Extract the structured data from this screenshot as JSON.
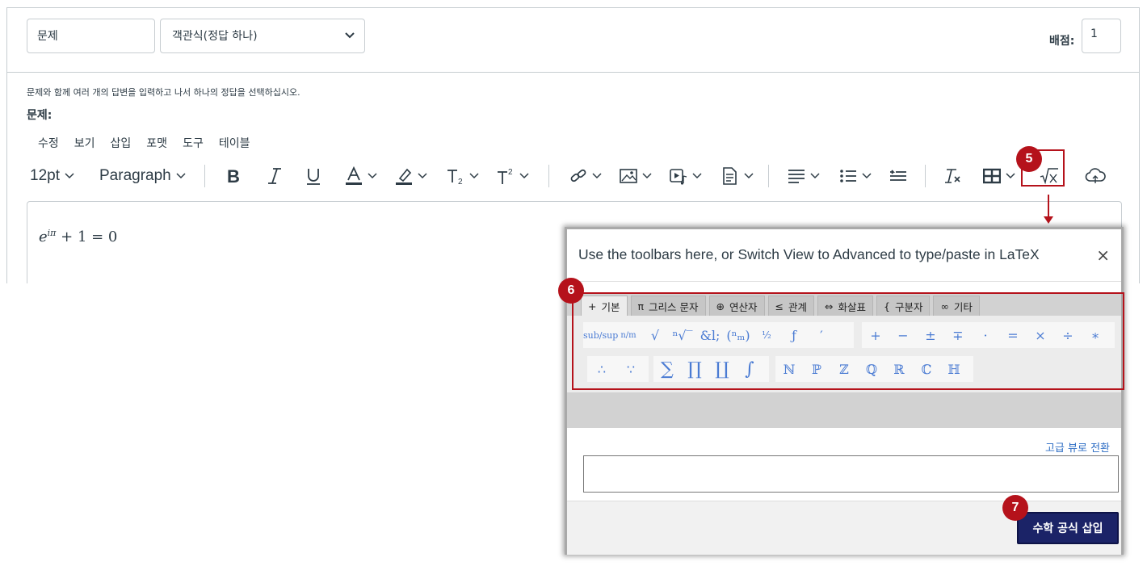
{
  "question": {
    "name_value": "문제",
    "type_value": "객관식(정답 하나)",
    "points_label": "배점:",
    "points_value": "1",
    "hint_text": "문제와 함께 여러 개의 답변을 입력하고 나서 하나의 정답을 선택하십시오.",
    "question_label": "문제:"
  },
  "menubar": [
    "수정",
    "보기",
    "삽입",
    "포맷",
    "도구",
    "테이블"
  ],
  "toolbar": {
    "font_size": "12pt",
    "block_format": "Paragraph",
    "icons": [
      "bold-icon",
      "italic-icon",
      "underline-icon",
      "text-color-icon",
      "highlight-icon",
      "subscript-icon",
      "superscript-icon",
      "link-icon",
      "image-icon",
      "media-icon",
      "document-icon",
      "align-icon",
      "list-icon",
      "indent-icon",
      "clear-format-icon",
      "table-icon",
      "math-equation-icon",
      "cloud-icon"
    ]
  },
  "editor": {
    "formula_base": "e",
    "formula_exp": "iπ",
    "formula_rest": "+ 1 = 0"
  },
  "callouts": {
    "c5": "5",
    "c6": "6",
    "c7": "7"
  },
  "dialog": {
    "title": "Use the toolbars here, or Switch View to Advanced to type/paste in LaTeX",
    "close_glyph": "×",
    "tabs": [
      {
        "icon": "+",
        "label": "기본"
      },
      {
        "icon": "π",
        "label": "그리스 문자"
      },
      {
        "icon": "⊕",
        "label": "연산자"
      },
      {
        "icon": "≤",
        "label": "관계"
      },
      {
        "icon": "⇔",
        "label": "화살표"
      },
      {
        "icon": "{",
        "label": "구분자"
      },
      {
        "icon": "∞",
        "label": "기타"
      }
    ],
    "row1_group1": [
      "sub/sup",
      "n/m",
      "√",
      "ⁿ√‾",
      "&l;",
      "(ⁿₘ)",
      "½",
      "ƒ",
      "′"
    ],
    "row1_group2": [
      "+",
      "−",
      "±",
      "∓",
      "·",
      "=",
      "×",
      "÷",
      "∗"
    ],
    "row2_group1": [
      "∴",
      "∵"
    ],
    "row2_group2": [
      "∑",
      "∏",
      "∐",
      "∫"
    ],
    "row2_group3": [
      "ℕ",
      "ℙ",
      "ℤ",
      "ℚ",
      "ℝ",
      "ℂ",
      "ℍ"
    ],
    "advanced_link": "고급 뷰로 전환",
    "insert_button": "수학 공식 삽입"
  },
  "colors": {
    "accent_red": "#b5121b",
    "insert_navy": "#1b2367",
    "symbol_blue": "#4a7bd3"
  }
}
